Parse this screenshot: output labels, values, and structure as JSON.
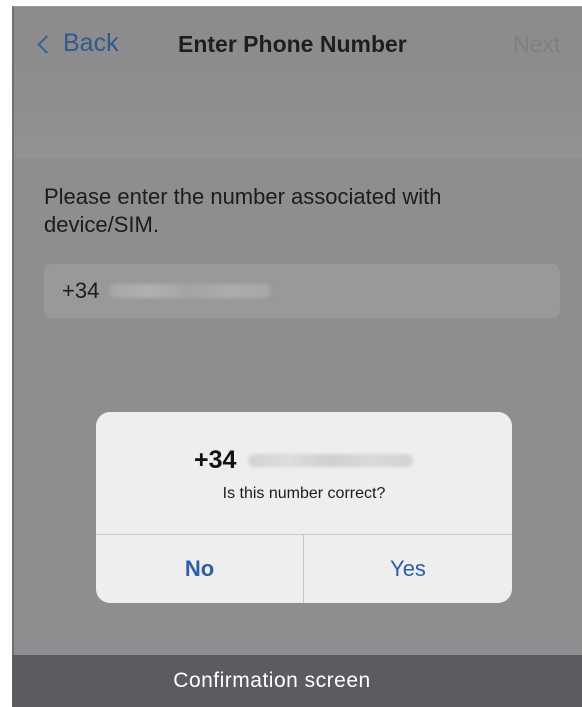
{
  "navbar": {
    "back_label": "Back",
    "title": "Enter Phone Number",
    "next_label": "Next"
  },
  "instructions": "Please enter the number associated with device/SIM.",
  "phone_field": {
    "country_code": "+34",
    "number_obscured": true
  },
  "dialog": {
    "country_code": "+34",
    "question": "Is this number correct?",
    "no_label": "No",
    "yes_label": "Yes"
  },
  "caption": "Confirmation screen",
  "colors": {
    "accent": "#2b5fa8",
    "overlay": "#8e8e90",
    "caption_bg": "#5c5c60"
  }
}
